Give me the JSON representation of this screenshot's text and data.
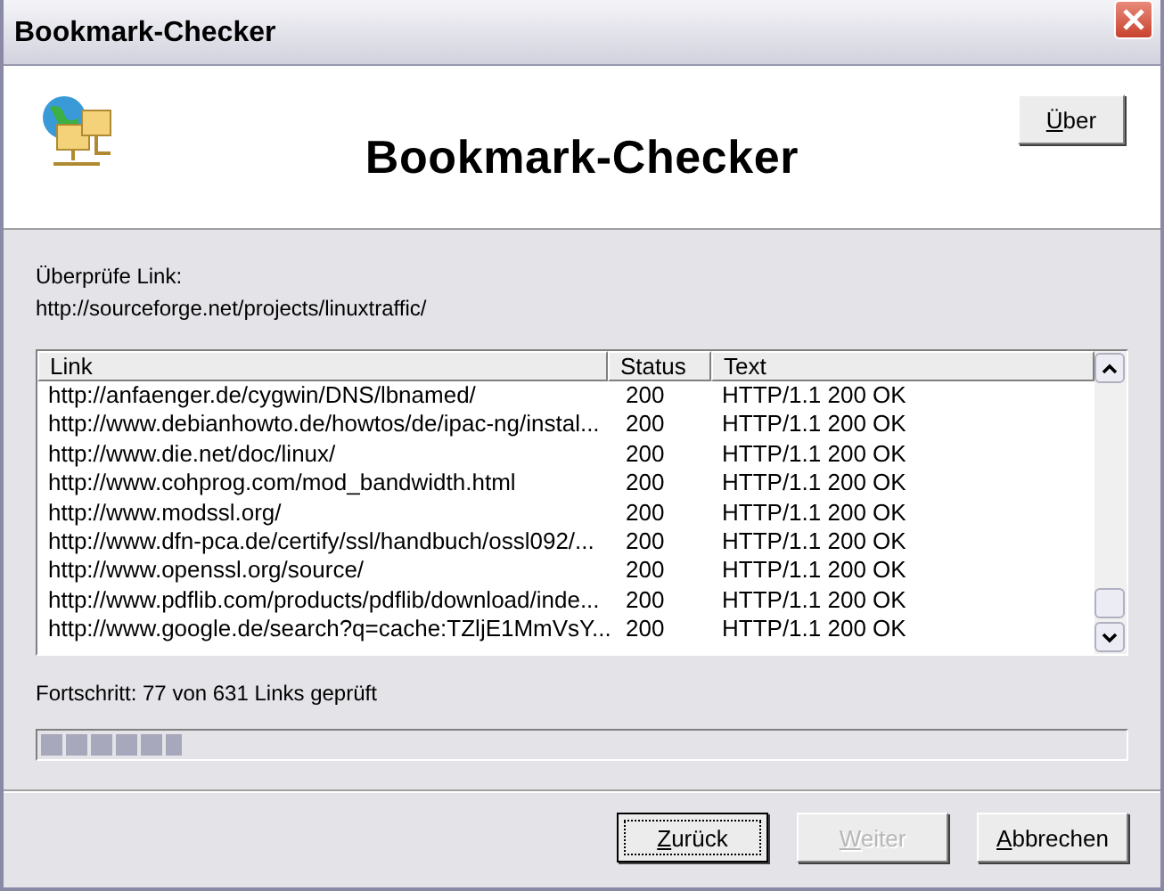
{
  "window": {
    "title": "Bookmark-Checker"
  },
  "header": {
    "title": "Bookmark-Checker",
    "about_button": "Über"
  },
  "current": {
    "label": "Überprüfe Link:",
    "url": "http://sourceforge.net/projects/linuxtraffic/"
  },
  "table": {
    "columns": [
      "Link",
      "Status",
      "Text"
    ],
    "rows": [
      {
        "link": "http://anfaenger.de/cygwin/DNS/lbnamed/",
        "status": "200",
        "text": "HTTP/1.1 200 OK"
      },
      {
        "link": "http://www.debianhowto.de/howtos/de/ipac-ng/instal...",
        "status": "200",
        "text": "HTTP/1.1 200 OK"
      },
      {
        "link": "http://www.die.net/doc/linux/",
        "status": "200",
        "text": "HTTP/1.1 200 OK"
      },
      {
        "link": "http://www.cohprog.com/mod_bandwidth.html",
        "status": "200",
        "text": "HTTP/1.1 200 OK"
      },
      {
        "link": "http://www.modssl.org/",
        "status": "200",
        "text": "HTTP/1.1 200 OK"
      },
      {
        "link": "http://www.dfn-pca.de/certify/ssl/handbuch/ossl092/...",
        "status": "200",
        "text": "HTTP/1.1 200 OK"
      },
      {
        "link": "http://www.openssl.org/source/",
        "status": "200",
        "text": "HTTP/1.1 200 OK"
      },
      {
        "link": "http://www.pdflib.com/products/pdflib/download/inde...",
        "status": "200",
        "text": "HTTP/1.1 200 OK"
      },
      {
        "link": "http://www.google.de/search?q=cache:TZljE1MmVsY...",
        "status": "200",
        "text": "HTTP/1.1 200 OK"
      }
    ]
  },
  "progress": {
    "label": "Fortschritt: 77 von 631 Links geprüft",
    "level": 0.13
  },
  "buttons": [
    {
      "label": "Zurück",
      "disabled": false,
      "default": true
    },
    {
      "label": "Weiter",
      "disabled": true,
      "default": false
    },
    {
      "label": "Abbrechen",
      "disabled": false,
      "default": false
    }
  ]
}
